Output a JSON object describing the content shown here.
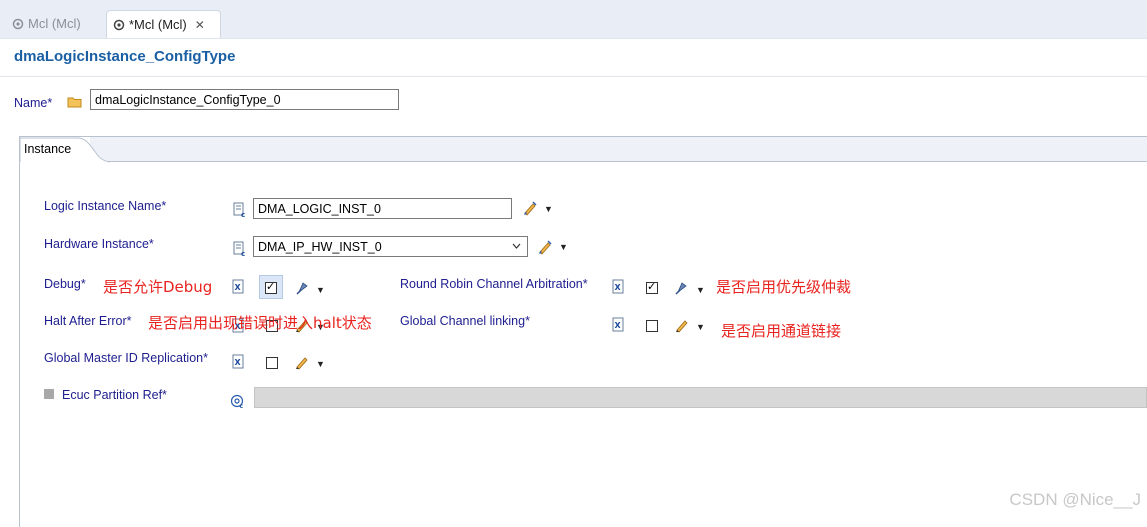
{
  "tabs": [
    {
      "label": "Mcl (Mcl)",
      "active": false
    },
    {
      "label": "*Mcl (Mcl)",
      "active": true,
      "close": "✕"
    }
  ],
  "page_title": "dmaLogicInstance_ConfigType",
  "name_field": {
    "label": "Name*",
    "value": "dmaLogicInstance_ConfigType_0"
  },
  "instance_tab": {
    "label": "Instance"
  },
  "fields": {
    "logic_instance_name": {
      "label": "Logic Instance Name*",
      "value": "DMA_LOGIC_INST_0"
    },
    "hardware_instance": {
      "label": "Hardware Instance*",
      "value": "DMA_IP_HW_INST_0"
    },
    "debug": {
      "label": "Debug*",
      "checked": true,
      "note": "是否允许Debug"
    },
    "halt_after_error": {
      "label": "Halt After Error*",
      "checked": false,
      "note": "是否启用出现错误时进入halt状态"
    },
    "global_master_id": {
      "label": "Global Master ID Replication*",
      "checked": false
    },
    "ecuc_partition_ref": {
      "label": "Ecuc Partition Ref*"
    },
    "round_robin": {
      "label": "Round Robin Channel Arbitration*",
      "checked": true,
      "note": "是否启用优先级仲裁"
    },
    "global_channel_linking": {
      "label": "Global Channel linking*",
      "checked": false,
      "note": "是否启用通道链接"
    }
  },
  "checkmark": "✓",
  "dropdown_caret": "▼",
  "watermark": "CSDN @Nice__J"
}
